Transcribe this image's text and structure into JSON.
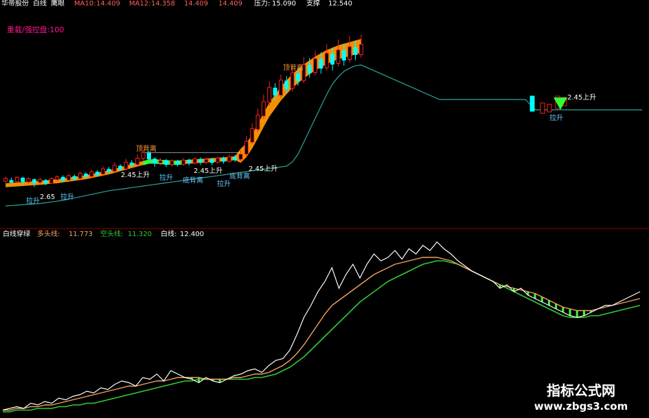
{
  "top_panel": {
    "header_left": "华帝股份",
    "indicator_name": "白线",
    "eye_label": "鹰眼",
    "ma10_label": "MA10:",
    "ma10_value": "14.409",
    "ma12_label": "MA12:",
    "ma12_value": "14.358",
    "val1": "14.409",
    "val2": "14.409",
    "pressure_label": "压力:",
    "pressure_value": "15.090",
    "support_label": "支撑",
    "support_value": "12.540",
    "control_text": "重载/强控盘:100"
  },
  "bottom_panel": {
    "name": "白线穿绿",
    "long_label": "多头线:",
    "long_value": "11.773",
    "short_label": "空头线:",
    "short_value": "11.320",
    "white_label": "白线:",
    "white_value": "12.400"
  },
  "annotations": {
    "top_div_1": "顶背离",
    "top_div_2": "顶背离",
    "bottom_div_1": "底背离",
    "bottom_div_2": "底背离",
    "rise_1": "拉升",
    "rise_2": "拉升",
    "rise_3": "拉升",
    "rise_4": "拉升",
    "rise_5": "拉升",
    "up_a": "2.45上升",
    "up_b": "2.45上升",
    "up_c": "2.45上升",
    "up_d": "2.45上升",
    "low_mark": "2.65"
  },
  "watermark": {
    "line1": "指标公式网",
    "line2": "www.zbgs3.com"
  },
  "colors": {
    "white_line": "#ffffff",
    "long_line": "#f4a460",
    "short_line": "#33cc33",
    "up_candle": "#ff2020",
    "down_candle": "#00ffff",
    "band": "#ff9900",
    "green_band": "#33ff33",
    "stop_line": "#2aa89a",
    "divider": "#8b0000"
  },
  "chart_data": [
    {
      "type": "candlestick",
      "title": "",
      "ylim": [
        11,
        16
      ],
      "candles": [
        {
          "x": 0,
          "o": 11.62,
          "c": 11.69,
          "h": 11.74,
          "l": 11.58
        },
        {
          "x": 1,
          "o": 11.64,
          "c": 11.59,
          "h": 11.71,
          "l": 11.57
        },
        {
          "x": 2,
          "o": 11.61,
          "c": 11.72,
          "h": 11.74,
          "l": 11.6
        },
        {
          "x": 3,
          "o": 11.7,
          "c": 11.61,
          "h": 11.73,
          "l": 11.52
        },
        {
          "x": 4,
          "o": 11.6,
          "c": 11.68,
          "h": 11.72,
          "l": 11.56
        },
        {
          "x": 5,
          "o": 11.66,
          "c": 11.58,
          "h": 11.69,
          "l": 11.47
        },
        {
          "x": 6,
          "o": 11.59,
          "c": 11.66,
          "h": 11.71,
          "l": 11.55
        },
        {
          "x": 7,
          "o": 11.64,
          "c": 11.57,
          "h": 11.68,
          "l": 11.52
        },
        {
          "x": 8,
          "o": 11.57,
          "c": 11.68,
          "h": 11.72,
          "l": 11.55
        },
        {
          "x": 9,
          "o": 11.66,
          "c": 11.73,
          "h": 11.77,
          "l": 11.62
        },
        {
          "x": 10,
          "o": 11.72,
          "c": 11.64,
          "h": 11.77,
          "l": 11.6
        },
        {
          "x": 11,
          "o": 11.65,
          "c": 11.76,
          "h": 11.8,
          "l": 11.63
        },
        {
          "x": 12,
          "o": 11.74,
          "c": 11.68,
          "h": 11.79,
          "l": 11.64
        },
        {
          "x": 13,
          "o": 11.69,
          "c": 11.82,
          "h": 11.86,
          "l": 11.66
        },
        {
          "x": 14,
          "o": 11.8,
          "c": 11.74,
          "h": 11.85,
          "l": 11.7
        },
        {
          "x": 15,
          "o": 11.74,
          "c": 11.86,
          "h": 11.91,
          "l": 11.71
        },
        {
          "x": 16,
          "o": 11.85,
          "c": 11.78,
          "h": 11.9,
          "l": 11.74
        },
        {
          "x": 17,
          "o": 11.8,
          "c": 11.93,
          "h": 11.99,
          "l": 11.77
        },
        {
          "x": 18,
          "o": 11.92,
          "c": 11.86,
          "h": 11.98,
          "l": 11.82
        },
        {
          "x": 19,
          "o": 11.87,
          "c": 12.02,
          "h": 12.1,
          "l": 11.84
        },
        {
          "x": 20,
          "o": 12.0,
          "c": 11.92,
          "h": 12.05,
          "l": 11.88
        },
        {
          "x": 21,
          "o": 11.93,
          "c": 12.1,
          "h": 12.18,
          "l": 11.9
        },
        {
          "x": 22,
          "o": 12.08,
          "c": 12.03,
          "h": 12.15,
          "l": 11.98
        },
        {
          "x": 23,
          "o": 12.04,
          "c": 12.2,
          "h": 12.3,
          "l": 12.0
        },
        {
          "x": 24,
          "o": 12.19,
          "c": 12.34,
          "h": 12.42,
          "l": 12.14
        },
        {
          "x": 25,
          "o": 12.33,
          "c": 12.18,
          "h": 12.38,
          "l": 12.1
        },
        {
          "x": 26,
          "o": 12.18,
          "c": 12.08,
          "h": 12.22,
          "l": 11.98
        },
        {
          "x": 27,
          "o": 12.08,
          "c": 12.14,
          "h": 12.2,
          "l": 12.02
        },
        {
          "x": 28,
          "o": 12.14,
          "c": 12.04,
          "h": 12.18,
          "l": 11.97
        },
        {
          "x": 29,
          "o": 12.04,
          "c": 12.13,
          "h": 12.17,
          "l": 11.99
        },
        {
          "x": 30,
          "o": 12.12,
          "c": 12.05,
          "h": 12.16,
          "l": 11.99
        },
        {
          "x": 31,
          "o": 12.05,
          "c": 12.15,
          "h": 12.2,
          "l": 12.01
        },
        {
          "x": 32,
          "o": 12.15,
          "c": 12.08,
          "h": 12.19,
          "l": 12.02
        },
        {
          "x": 33,
          "o": 12.08,
          "c": 12.18,
          "h": 12.22,
          "l": 12.04
        },
        {
          "x": 34,
          "o": 12.17,
          "c": 12.1,
          "h": 12.22,
          "l": 12.03
        },
        {
          "x": 35,
          "o": 12.1,
          "c": 12.17,
          "h": 12.21,
          "l": 12.05
        },
        {
          "x": 36,
          "o": 12.16,
          "c": 12.09,
          "h": 12.21,
          "l": 12.02
        },
        {
          "x": 37,
          "o": 12.1,
          "c": 12.2,
          "h": 12.24,
          "l": 12.06
        },
        {
          "x": 38,
          "o": 12.19,
          "c": 12.12,
          "h": 12.24,
          "l": 12.06
        },
        {
          "x": 39,
          "o": 12.12,
          "c": 12.23,
          "h": 12.3,
          "l": 12.08
        },
        {
          "x": 40,
          "o": 12.22,
          "c": 12.16,
          "h": 12.28,
          "l": 12.1
        },
        {
          "x": 41,
          "o": 12.17,
          "c": 12.3,
          "h": 12.4,
          "l": 12.12
        },
        {
          "x": 42,
          "o": 12.3,
          "c": 12.62,
          "h": 12.76,
          "l": 12.24
        },
        {
          "x": 43,
          "o": 12.6,
          "c": 12.94,
          "h": 13.08,
          "l": 12.55
        },
        {
          "x": 44,
          "o": 12.92,
          "c": 13.28,
          "h": 13.44,
          "l": 12.86
        },
        {
          "x": 45,
          "o": 13.26,
          "c": 13.62,
          "h": 13.8,
          "l": 13.18
        },
        {
          "x": 46,
          "o": 13.6,
          "c": 13.98,
          "h": 14.14,
          "l": 13.52
        },
        {
          "x": 47,
          "o": 13.96,
          "c": 13.78,
          "h": 14.08,
          "l": 13.64
        },
        {
          "x": 48,
          "o": 13.78,
          "c": 14.16,
          "h": 14.3,
          "l": 13.7
        },
        {
          "x": 49,
          "o": 14.14,
          "c": 13.94,
          "h": 14.26,
          "l": 13.82
        },
        {
          "x": 50,
          "o": 13.95,
          "c": 14.34,
          "h": 14.52,
          "l": 13.88
        },
        {
          "x": 51,
          "o": 14.32,
          "c": 14.14,
          "h": 14.5,
          "l": 14.02
        },
        {
          "x": 52,
          "o": 14.15,
          "c": 14.55,
          "h": 14.74,
          "l": 14.08
        },
        {
          "x": 53,
          "o": 14.53,
          "c": 14.34,
          "h": 14.72,
          "l": 14.22
        },
        {
          "x": 54,
          "o": 14.35,
          "c": 14.7,
          "h": 14.9,
          "l": 14.28
        },
        {
          "x": 55,
          "o": 14.68,
          "c": 14.46,
          "h": 14.86,
          "l": 14.32
        },
        {
          "x": 56,
          "o": 14.47,
          "c": 14.84,
          "h": 15.06,
          "l": 14.4
        },
        {
          "x": 57,
          "o": 14.82,
          "c": 14.56,
          "h": 14.98,
          "l": 14.4
        },
        {
          "x": 58,
          "o": 14.58,
          "c": 14.92,
          "h": 15.18,
          "l": 14.5
        },
        {
          "x": 59,
          "o": 14.9,
          "c": 14.66,
          "h": 15.08,
          "l": 14.52
        },
        {
          "x": 60,
          "o": 14.68,
          "c": 15.0,
          "h": 15.26,
          "l": 14.6
        },
        {
          "x": 61,
          "o": 14.98,
          "c": 14.8,
          "h": 15.16,
          "l": 14.66
        },
        {
          "x": 62,
          "o": 14.8,
          "c": 15.06,
          "h": 15.3,
          "l": 14.72
        }
      ],
      "series": [
        {
          "values": [
            11.52,
            11.53,
            11.54,
            11.55,
            11.56,
            11.57,
            11.58,
            11.59,
            11.61,
            11.62,
            11.64,
            11.66,
            11.68,
            11.7,
            11.72,
            11.75,
            11.78,
            11.81,
            11.84,
            11.88,
            11.92,
            11.96,
            12.0,
            12.04,
            12.08,
            12.12,
            12.12,
            12.11,
            12.1,
            12.09,
            12.09,
            12.1,
            12.11,
            12.12,
            12.13,
            12.14,
            12.15,
            12.16,
            12.17,
            12.18,
            12.2,
            12.26,
            12.4,
            12.62,
            12.88,
            13.16,
            13.42,
            13.62,
            13.82,
            13.98,
            14.14,
            14.26,
            14.38,
            14.48,
            14.58,
            14.66,
            14.74,
            14.8,
            14.86,
            14.9,
            14.94,
            14.98,
            15.02
          ]
        },
        {
          "values": [
            11.0,
            11.01,
            11.02,
            11.03,
            11.04,
            11.05,
            11.06,
            11.08,
            11.1,
            11.12,
            11.14,
            11.17,
            11.2,
            11.23,
            11.26,
            11.29,
            11.32,
            11.35,
            11.38,
            11.4,
            11.42,
            11.44,
            11.46,
            11.48,
            11.5,
            11.52,
            11.54,
            11.56,
            11.58,
            11.6,
            11.62,
            11.64,
            11.66,
            11.68,
            11.7,
            11.72,
            11.74,
            11.76,
            11.78,
            11.8,
            11.82,
            11.84,
            11.86,
            11.88,
            11.9,
            11.92,
            11.94,
            11.96,
            11.98,
            12.0,
            12.1,
            12.3,
            12.6,
            12.9,
            13.2,
            13.5,
            13.8,
            14.06,
            14.24,
            14.38,
            14.46,
            14.52,
            14.54
          ]
        }
      ],
      "pressure": 15.09,
      "support": 12.54
    },
    {
      "type": "line",
      "title": "",
      "ylim": [
        0,
        100
      ],
      "series": [
        {
          "values": [
            1,
            2,
            3,
            2,
            5,
            4,
            6,
            5,
            8,
            7,
            9,
            10,
            12,
            11,
            14,
            13,
            16,
            18,
            17,
            15,
            20,
            19,
            22,
            18,
            24,
            22,
            20,
            19,
            17,
            20,
            18,
            17,
            19,
            21,
            22,
            24,
            25,
            23,
            27,
            30,
            31,
            36,
            45,
            55,
            62,
            70,
            76,
            84,
            72,
            80,
            86,
            78,
            86,
            92,
            88,
            90,
            94,
            89,
            95,
            92,
            97,
            94,
            99,
            95,
            92,
            88,
            85,
            82,
            80,
            78,
            76,
            72,
            74,
            70,
            72,
            68,
            66,
            64,
            62,
            60,
            58,
            56,
            55,
            56,
            58,
            60,
            62,
            62,
            64,
            66,
            68,
            70
          ]
        },
        {
          "values": [
            1,
            1,
            2,
            2,
            3,
            3,
            4,
            4,
            5,
            6,
            7,
            8,
            9,
            10,
            11,
            12,
            13,
            14,
            15,
            15,
            16,
            17,
            18,
            18,
            19,
            20,
            20,
            20,
            20,
            19,
            19,
            19,
            19,
            20,
            20,
            21,
            22,
            22,
            23,
            25,
            27,
            30,
            34,
            39,
            45,
            51,
            57,
            62,
            65,
            68,
            71,
            74,
            77,
            80,
            82,
            84,
            86,
            87,
            88,
            89,
            90,
            90,
            90,
            89,
            88,
            86,
            84,
            82,
            80,
            78,
            76,
            74,
            73,
            72,
            71,
            70,
            69,
            67,
            65,
            63,
            61,
            60,
            59,
            59,
            59,
            60,
            61,
            62,
            63,
            64,
            65,
            66
          ]
        },
        {
          "values": [
            0,
            0,
            1,
            1,
            1,
            2,
            2,
            2,
            3,
            3,
            4,
            4,
            5,
            5,
            6,
            7,
            8,
            9,
            10,
            11,
            12,
            13,
            14,
            15,
            16,
            17,
            18,
            18,
            19,
            19,
            19,
            19,
            19,
            19,
            19,
            19,
            20,
            20,
            21,
            22,
            24,
            26,
            29,
            32,
            36,
            40,
            44,
            48,
            52,
            56,
            60,
            64,
            67,
            70,
            73,
            76,
            78,
            80,
            82,
            84,
            86,
            87,
            88,
            88,
            87,
            86,
            84,
            82,
            80,
            78,
            76,
            74,
            72,
            70,
            68,
            66,
            64,
            62,
            60,
            58,
            56,
            55,
            55,
            55,
            56,
            56,
            57,
            58,
            59,
            60,
            61,
            62
          ]
        }
      ]
    }
  ]
}
